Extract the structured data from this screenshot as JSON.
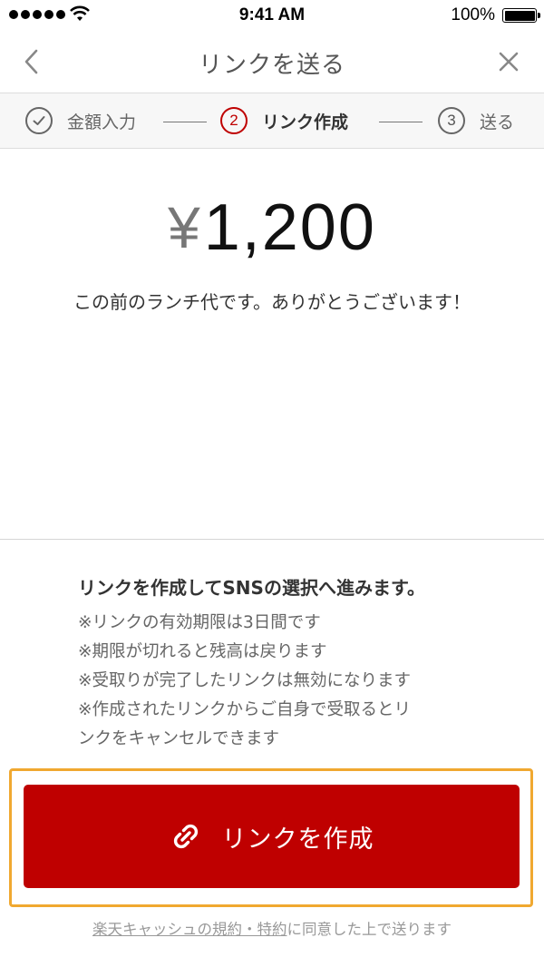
{
  "status_bar": {
    "time": "9:41 AM",
    "battery_percent": "100%",
    "battery_level": 1.0
  },
  "nav": {
    "title": "リンクを送る",
    "back_icon": "chevron-left-icon",
    "close_icon": "close-icon"
  },
  "steps": [
    {
      "number": "",
      "label": "金額入力",
      "state": "done",
      "icon": "check-circle-icon"
    },
    {
      "number": "2",
      "label": "リンク作成",
      "state": "active"
    },
    {
      "number": "3",
      "label": "送る",
      "state": "pending"
    }
  ],
  "amount": {
    "currency": "¥",
    "value": "1,200"
  },
  "message": "この前のランチ代です。ありがとうございます！",
  "notice": {
    "title": "リンクを作成してSNSの選択へ進みます。",
    "lines": [
      "※リンクの有効期限は3日間です",
      "※期限が切れると残高は戻ります",
      "※受取りが完了したリンクは無効になります",
      "※作成されたリンクからご自身で受取るとリ",
      "ンクをキャンセルできます"
    ]
  },
  "create_button": {
    "label": "リンクを作成",
    "icon": "link-icon"
  },
  "terms": {
    "link_text": "楽天キャッシュの規約・特約",
    "suffix": "に同意した上で送ります"
  },
  "colors": {
    "brand_red": "#bf0000",
    "highlight_border": "#f0a830",
    "step_bar_bg": "#f7f7f7"
  }
}
